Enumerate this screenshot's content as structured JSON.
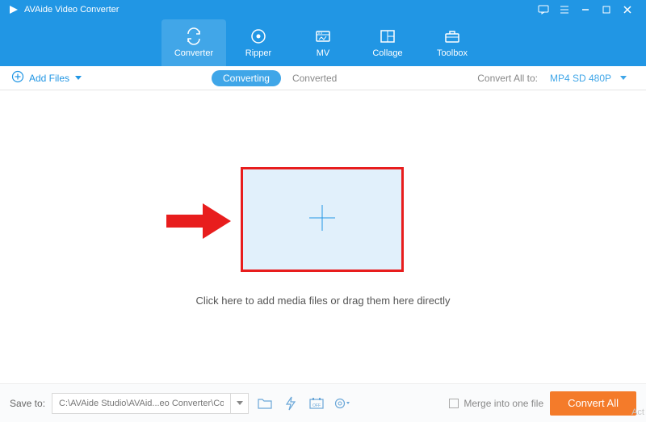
{
  "titlebar": {
    "app_name": "AVAide Video Converter"
  },
  "nav": {
    "items": [
      {
        "label": "Converter"
      },
      {
        "label": "Ripper"
      },
      {
        "label": "MV"
      },
      {
        "label": "Collage"
      },
      {
        "label": "Toolbox"
      }
    ]
  },
  "subbar": {
    "add_files": "Add Files",
    "tab_converting": "Converting",
    "tab_converted": "Converted",
    "convert_all_to": "Convert All to:",
    "format": "MP4 SD 480P"
  },
  "main": {
    "hint": "Click here to add media files or drag them here directly"
  },
  "footer": {
    "save_to_label": "Save to:",
    "save_path": "C:\\AVAide Studio\\AVAid...eo Converter\\Converted",
    "merge_label": "Merge into one file",
    "convert_all": "Convert All"
  },
  "watermark": "Act"
}
